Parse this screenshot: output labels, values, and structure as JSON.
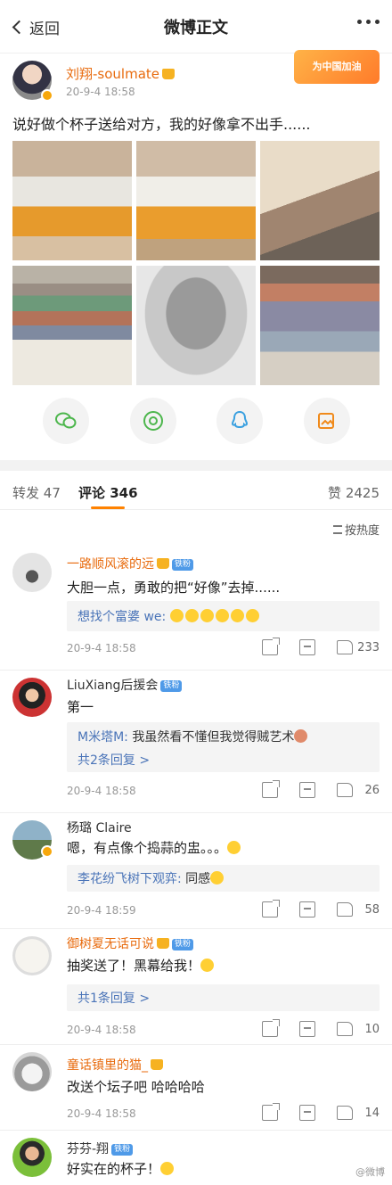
{
  "header": {
    "back_label": "返回",
    "title": "微博正文"
  },
  "post": {
    "author": "刘翔-soulmate",
    "time": "20-9-4 18:58",
    "promo_badge": "为中国加油",
    "text": "说好做个杯子送给对方，我的好像拿不出手......"
  },
  "tabs": {
    "repost_label": "转发",
    "repost_count": "47",
    "comment_label": "评论",
    "comment_count": "346",
    "like_label": "赞",
    "like_count": "2425"
  },
  "sort_label": "按热度",
  "fan_badge": "铁粉",
  "comments": [
    {
      "user": "一路顺风滚的远",
      "text": "大胆一点，勇敢的把“好像”去掉......",
      "reply_user": "想找个富婆",
      "reply_text": " we: ",
      "time": "20-9-4 18:58",
      "likes": "233"
    },
    {
      "user": "LiuXiang后援会",
      "text": "第一",
      "reply_user": "M米塔M:",
      "reply_text": " 我虽然看不懂但我觉得贼艺术",
      "reply_more": "共2条回复 >",
      "time": "20-9-4 18:58",
      "likes": "26"
    },
    {
      "user": "杨璐 Claire",
      "text": "嗯，有点像个捣蒜的盅。。。",
      "reply_user": "李花纷飞树下观弈:",
      "reply_text": " 同感",
      "time": "20-9-4 18:59",
      "likes": "58"
    },
    {
      "user": "御树夏无话可说",
      "text": "抽奖送了！黑幕给我！",
      "reply_more": "共1条回复 >",
      "time": "20-9-4 18:58",
      "likes": "10"
    },
    {
      "user": "童话镇里的猫_",
      "text": "改送个坛子吧 哈哈哈哈",
      "time": "20-9-4 18:58",
      "likes": "14"
    },
    {
      "user": "芬芬-翔",
      "text": "好实在的杯子！"
    }
  ],
  "watermark": "@微博"
}
